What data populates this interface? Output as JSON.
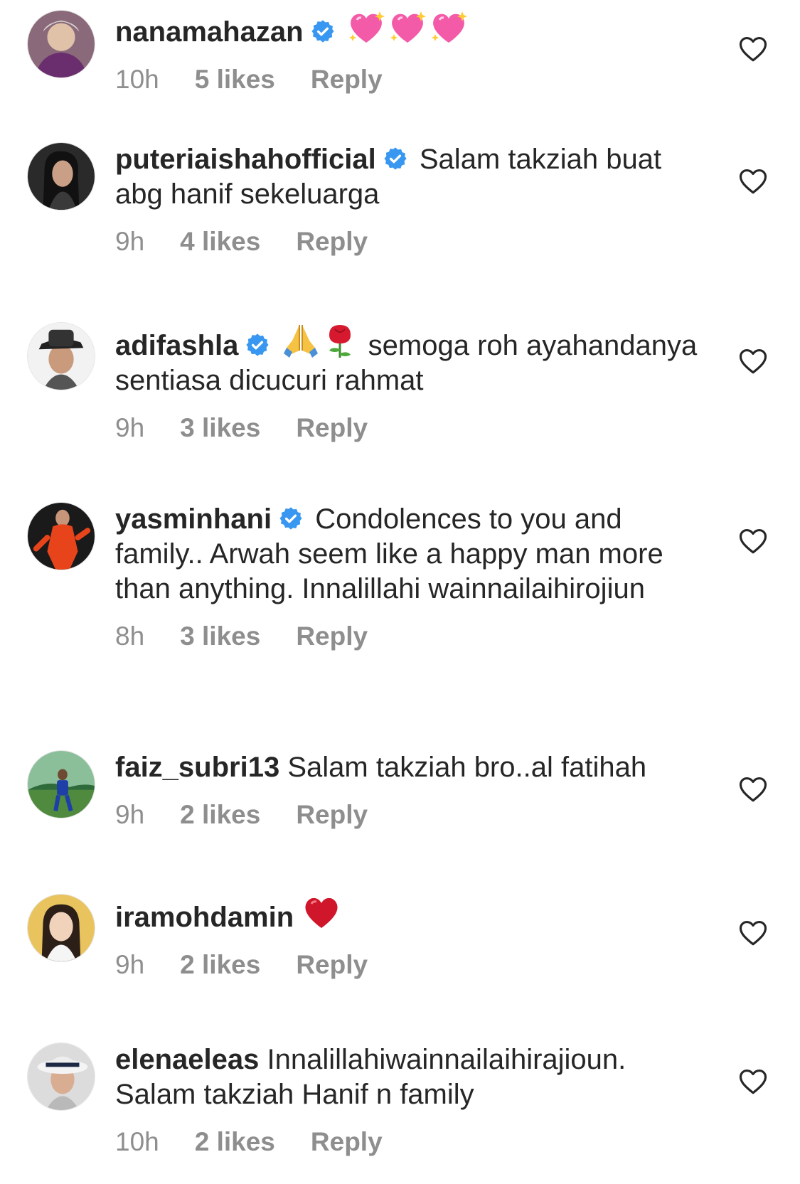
{
  "comments": [
    {
      "username": "nanamahazan",
      "verified": true,
      "emojis": [
        "sparkling-heart",
        "sparkling-heart",
        "sparkling-heart"
      ],
      "text": "",
      "time": "10h",
      "likes": "5 likes",
      "reply": "Reply"
    },
    {
      "username": "puteriaishahofficial",
      "verified": true,
      "emojis": [],
      "text": "Salam takziah buat abg hanif sekeluarga",
      "time": "9h",
      "likes": "4 likes",
      "reply": "Reply"
    },
    {
      "username": "adifashla",
      "verified": true,
      "emojis": [
        "folded-hands",
        "rose"
      ],
      "text": "semoga roh ayahandanya sentiasa dicucuri rahmat",
      "time": "9h",
      "likes": "3 likes",
      "reply": "Reply"
    },
    {
      "username": "yasminhani",
      "verified": true,
      "emojis": [],
      "text": "Condolences to you and family.. Arwah seem like a happy man more than anything. Innalillahi wainnailaihirojiun",
      "time": "8h",
      "likes": "3 likes",
      "reply": "Reply"
    },
    {
      "username": "faiz_subri13",
      "verified": false,
      "emojis": [],
      "text": "Salam takziah bro..al fatihah",
      "time": "9h",
      "likes": "2 likes",
      "reply": "Reply"
    },
    {
      "username": "iramohdamin",
      "verified": false,
      "emojis": [
        "red-heart"
      ],
      "text": "",
      "time": "9h",
      "likes": "2 likes",
      "reply": "Reply"
    },
    {
      "username": "elenaeleas",
      "verified": false,
      "emojis": [],
      "text": "Innalillahiwainnailaihirajioun. Salam takziah Hanif n family",
      "time": "10h",
      "likes": "2 likes",
      "reply": "Reply"
    }
  ],
  "colors": {
    "text": "#262626",
    "meta": "#8e8e8e",
    "verified": "#3897f0",
    "heart_outline": "#262626"
  },
  "icons": {
    "verified": "verified-badge-icon",
    "like": "heart-outline-icon"
  }
}
